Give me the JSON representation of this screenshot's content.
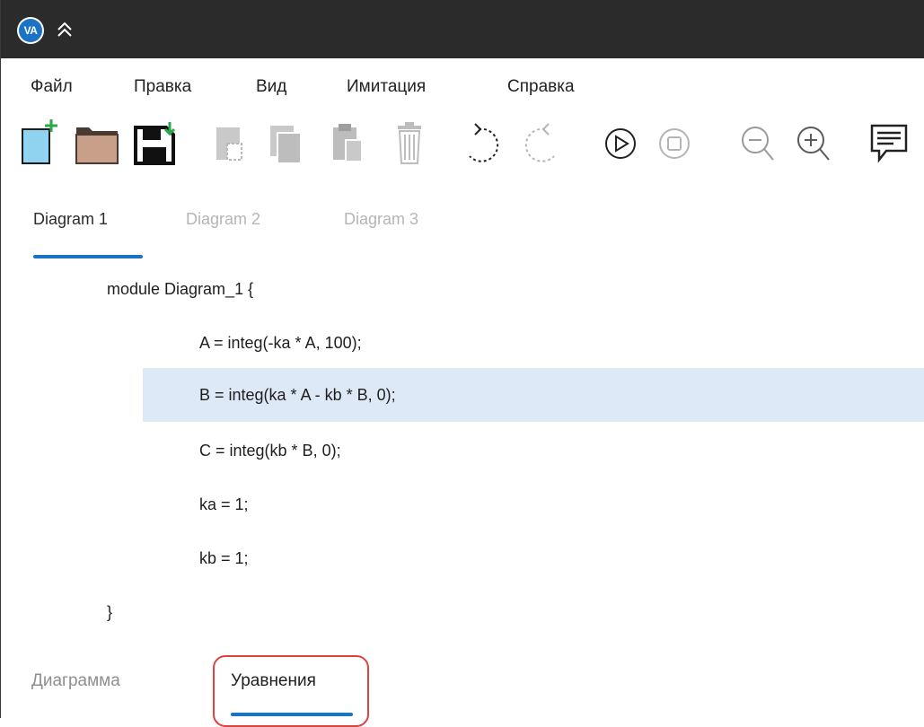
{
  "app": {
    "logo_text": "VA"
  },
  "menu": {
    "items": [
      {
        "label": "Файл"
      },
      {
        "label": "Правка"
      },
      {
        "label": "Вид"
      },
      {
        "label": "Имитация"
      },
      {
        "label": "Справка"
      }
    ]
  },
  "toolbar": {
    "buttons": [
      {
        "icon": "new-file-icon"
      },
      {
        "icon": "open-folder-icon"
      },
      {
        "icon": "save-icon"
      },
      {
        "icon": "cut-icon"
      },
      {
        "icon": "copy-icon"
      },
      {
        "icon": "paste-icon"
      },
      {
        "icon": "delete-icon"
      },
      {
        "icon": "undo-icon"
      },
      {
        "icon": "redo-icon"
      },
      {
        "icon": "play-icon"
      },
      {
        "icon": "stop-icon"
      },
      {
        "icon": "zoom-out-icon"
      },
      {
        "icon": "zoom-in-icon"
      },
      {
        "icon": "comment-icon"
      }
    ]
  },
  "document_tabs": [
    {
      "label": "Diagram 1",
      "active": true
    },
    {
      "label": "Diagram 2",
      "active": false
    },
    {
      "label": "Diagram 3",
      "active": false
    }
  ],
  "code": {
    "lines": [
      {
        "text": "module Diagram_1 {",
        "indent": 0
      },
      {
        "text": "A = integ(-ka * A, 100);",
        "indent": 1
      },
      {
        "text": "B = integ(ka * A - kb * B, 0);",
        "indent": 1,
        "highlighted": true
      },
      {
        "text": "C = integ(kb * B, 0);",
        "indent": 1
      },
      {
        "text": "ka = 1;",
        "indent": 1
      },
      {
        "text": "kb = 1;",
        "indent": 1
      },
      {
        "text": "}",
        "indent": 0
      }
    ]
  },
  "view_tabs": [
    {
      "label": "Диаграмма",
      "active": false
    },
    {
      "label": "Уравнения",
      "active": true
    }
  ],
  "colors": {
    "titlebar": "#2b2b2b",
    "accent": "#1a73c4",
    "highlight": "#dde9f7",
    "focus_ring": "#e0423f"
  }
}
